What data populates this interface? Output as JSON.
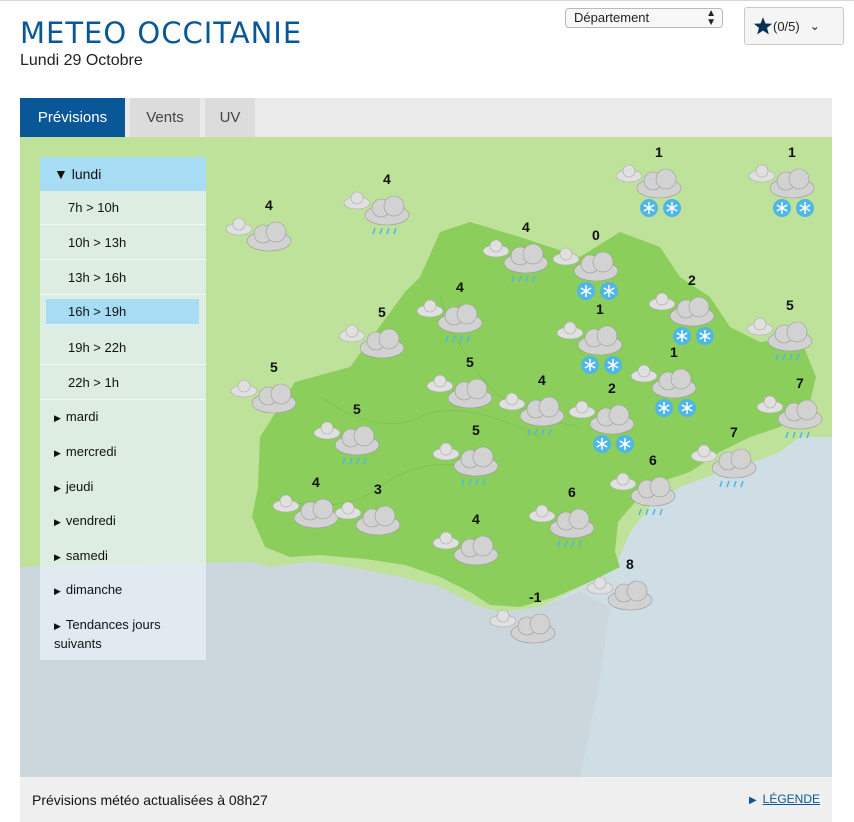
{
  "header": {
    "title": "METEO OCCITANIE",
    "date": "Lundi 29 Octobre",
    "department_select": "Département",
    "favorites": "(0/5)"
  },
  "tabs": [
    {
      "label": "Prévisions",
      "active": true
    },
    {
      "label": "Vents",
      "active": false
    },
    {
      "label": "UV",
      "active": false
    }
  ],
  "day_panel": {
    "current_day": "lundi",
    "slots": [
      "7h > 10h",
      "10h > 13h",
      "13h > 16h",
      "16h > 19h",
      "19h > 22h",
      "22h > 1h"
    ],
    "selected_slot": "16h > 19h",
    "other_days": [
      "mardi",
      "mercredi",
      "jeudi",
      "vendredi",
      "samedi",
      "dimanche",
      "Tendances jours suivants"
    ]
  },
  "map": {
    "colors": {
      "land_region": "#8cce5c",
      "land_outside": "#bfe29b",
      "sea": "#cfdde5",
      "cloud": "#d2d2d2",
      "snow": "#4fb6e8"
    },
    "forecasts": [
      {
        "temp": "1",
        "icon": "snow"
      },
      {
        "temp": "1",
        "icon": "snow"
      },
      {
        "temp": "4",
        "icon": "rain"
      },
      {
        "temp": "4",
        "icon": "cloud"
      },
      {
        "temp": "4",
        "icon": "rain"
      },
      {
        "temp": "0",
        "icon": "snow"
      },
      {
        "temp": "4",
        "icon": "rain"
      },
      {
        "temp": "2",
        "icon": "snow"
      },
      {
        "temp": "5",
        "icon": "cloud"
      },
      {
        "temp": "1",
        "icon": "snow"
      },
      {
        "temp": "5",
        "icon": "rain"
      },
      {
        "temp": "5",
        "icon": "cloud"
      },
      {
        "temp": "5",
        "icon": "cloud"
      },
      {
        "temp": "1",
        "icon": "snow"
      },
      {
        "temp": "4",
        "icon": "rain"
      },
      {
        "temp": "2",
        "icon": "snow"
      },
      {
        "temp": "7",
        "icon": "rain"
      },
      {
        "temp": "5",
        "icon": "rain"
      },
      {
        "temp": "5",
        "icon": "rain"
      },
      {
        "temp": "7",
        "icon": "rain"
      },
      {
        "temp": "6",
        "icon": "rain"
      },
      {
        "temp": "4",
        "icon": "cloud"
      },
      {
        "temp": "3",
        "icon": "cloud"
      },
      {
        "temp": "6",
        "icon": "rain"
      },
      {
        "temp": "4",
        "icon": "cloud"
      },
      {
        "temp": "8",
        "icon": "cloud"
      },
      {
        "temp": "-1",
        "icon": "cloud"
      }
    ]
  },
  "footer": {
    "update_text": "Prévisions météo actualisées à 08h27",
    "legend_link": "LÉGENDE"
  }
}
